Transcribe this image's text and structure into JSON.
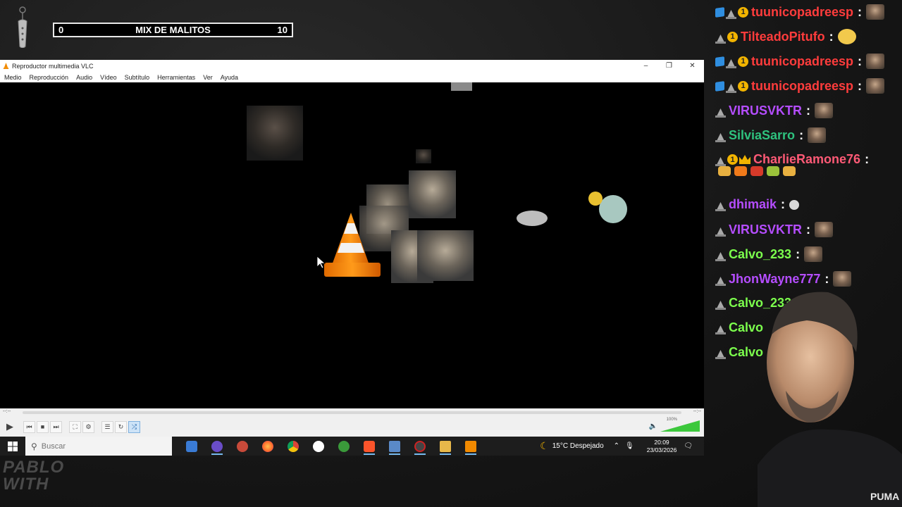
{
  "overlay": {
    "score_left": "0",
    "score_title": "MIX DE MALITOS",
    "score_right": "10",
    "watermark": "PABLO\nWITH"
  },
  "vlc": {
    "window_title": "Reproductor multimedia VLC",
    "menu": [
      "Medio",
      "Reproducción",
      "Audio",
      "Vídeo",
      "Subtítulo",
      "Herramientas",
      "Ver",
      "Ayuda"
    ],
    "time_elapsed": "--:--",
    "time_total": "--:--",
    "volume_label": "100%",
    "volume_level": 1.0
  },
  "taskbar": {
    "search_placeholder": "Buscar",
    "weather": "15°C  Despejado",
    "time": "20:09",
    "date": "23/03/2026",
    "apps": [
      "store-icon",
      "obs-icon",
      "capture-icon",
      "firefox-icon",
      "chrome-icon",
      "media-player-icon",
      "xbox-icon",
      "brave-icon",
      "app-icon",
      "screen-recorder-icon",
      "file-explorer-icon",
      "vlc-icon"
    ]
  },
  "chat": {
    "messages": [
      {
        "user": "tuunicopadreesp",
        "color": "#ff3c3c",
        "badges": [
          "cube",
          "hat",
          "one"
        ],
        "emote": "face"
      },
      {
        "user": "TilteadoPitufo",
        "color": "#ff3c3c",
        "badges": [
          "hat",
          "one"
        ],
        "emote": "yellow"
      },
      {
        "user": "tuunicopadreesp",
        "color": "#ff3c3c",
        "badges": [
          "cube",
          "hat",
          "one"
        ],
        "emote": "face"
      },
      {
        "user": "tuunicopadreesp",
        "color": "#ff3c3c",
        "badges": [
          "cube",
          "hat",
          "one"
        ],
        "emote": "face"
      },
      {
        "user": "VIRUSVKTR",
        "color": "#b54dff",
        "badges": [
          "hat"
        ],
        "emote": "face"
      },
      {
        "user": "SilviaSarro",
        "color": "#2ec27e",
        "badges": [
          "hat"
        ],
        "emote": "face"
      },
      {
        "user": "CharlieRamone76",
        "color": "#ff5a76",
        "badges": [
          "hat",
          "one",
          "crown"
        ],
        "emote": ""
      },
      {
        "user": "dhimaik",
        "color": "#b54dff",
        "badges": [
          "hat"
        ],
        "emote": "hand"
      },
      {
        "user": "VIRUSVKTR",
        "color": "#b54dff",
        "badges": [
          "hat"
        ],
        "emote": "face"
      },
      {
        "user": "Calvo_233",
        "color": "#7cff4d",
        "badges": [
          "hat"
        ],
        "emote": "face"
      },
      {
        "user": "JhonWayne777",
        "color": "#b54dff",
        "badges": [
          "hat"
        ],
        "emote": "face"
      },
      {
        "user": "Calvo_233",
        "color": "#7cff4d",
        "badges": [
          "hat"
        ],
        "emote": ""
      },
      {
        "user": "Calvo",
        "color": "#7cff4d",
        "badges": [
          "hat"
        ],
        "emote": ""
      },
      {
        "user": "Calvo",
        "color": "#7cff4d",
        "badges": [
          "hat"
        ],
        "emote": ""
      }
    ],
    "food_emotes": [
      "#e8b040",
      "#f07a1a",
      "#d63a2a",
      "#9bc23a",
      "#e8b040"
    ]
  }
}
